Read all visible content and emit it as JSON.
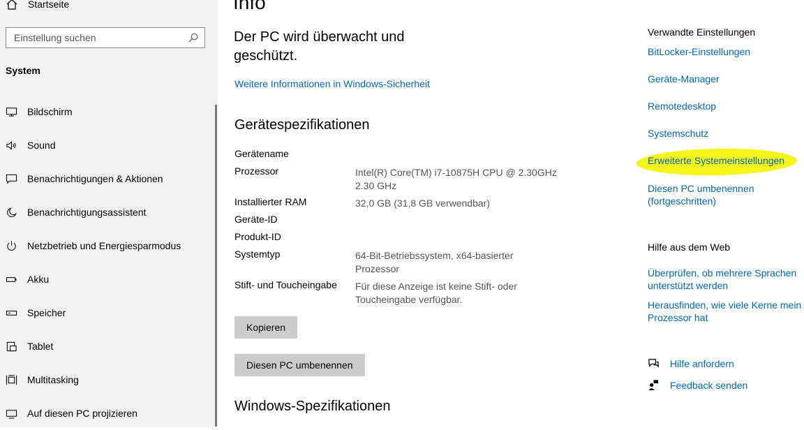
{
  "sidebar": {
    "home_label": "Startseite",
    "search_placeholder": "Einstellung suchen",
    "section_title": "System",
    "items": [
      {
        "label": "Bildschirm",
        "icon": "monitor-icon"
      },
      {
        "label": "Sound",
        "icon": "speaker-icon"
      },
      {
        "label": "Benachrichtigungen & Aktionen",
        "icon": "notification-icon"
      },
      {
        "label": "Benachrichtigungsassistent",
        "icon": "moon-icon"
      },
      {
        "label": "Netzbetrieb und Energiesparmodus",
        "icon": "power-icon"
      },
      {
        "label": "Akku",
        "icon": "battery-icon"
      },
      {
        "label": "Speicher",
        "icon": "storage-icon"
      },
      {
        "label": "Tablet",
        "icon": "tablet-icon"
      },
      {
        "label": "Multitasking",
        "icon": "multitasking-icon"
      },
      {
        "label": "Auf diesen PC projizieren",
        "icon": "project-icon"
      }
    ]
  },
  "main": {
    "title": "Info",
    "protection_text": "Der PC wird überwacht und geschützt.",
    "security_link": "Weitere Informationen in Windows-Sicherheit",
    "device_specs_heading": "Gerätespezifikationen",
    "specs": {
      "device_name": {
        "label": "Gerätename",
        "value": ""
      },
      "processor": {
        "label": "Prozessor",
        "value": "Intel(R) Core(TM) i7-10875H CPU @ 2.30GHz 2.30 GHz"
      },
      "ram": {
        "label": "Installierter RAM",
        "value": "32,0 GB (31,8 GB verwendbar)"
      },
      "device_id": {
        "label": "Geräte-ID",
        "value": ""
      },
      "product_id": {
        "label": "Produkt-ID",
        "value": ""
      },
      "system_type": {
        "label": "Systemtyp",
        "value": "64-Bit-Betriebssystem, x64-basierter Prozessor"
      },
      "pen_touch": {
        "label": "Stift- und Toucheingabe",
        "value": "Für diese Anzeige ist keine Stift- oder Toucheingabe verfügbar."
      }
    },
    "copy_button": "Kopieren",
    "rename_button": "Diesen PC umbenennen",
    "windows_specs_heading": "Windows-Spezifikationen"
  },
  "related": {
    "heading": "Verwandte Einstellungen",
    "links": [
      "BitLocker-Einstellungen",
      "Geräte-Manager",
      "Remotedesktop",
      "Systemschutz",
      "Erweiterte Systemeinstellungen",
      "Diesen PC umbenennen (fortgeschritten)"
    ],
    "highlight_color": "#f5f51a"
  },
  "web_help": {
    "heading": "Hilfe aus dem Web",
    "links": [
      "Überprüfen, ob mehrere Sprachen unterstützt werden",
      "Herausfinden, wie viele Kerne mein Prozessor hat"
    ]
  },
  "support": {
    "get_help": "Hilfe anfordern",
    "feedback": "Feedback senden"
  },
  "colors": {
    "link": "#0067b8",
    "sidebar_bg": "#f2f2f2",
    "button_bg": "#cccccc"
  }
}
